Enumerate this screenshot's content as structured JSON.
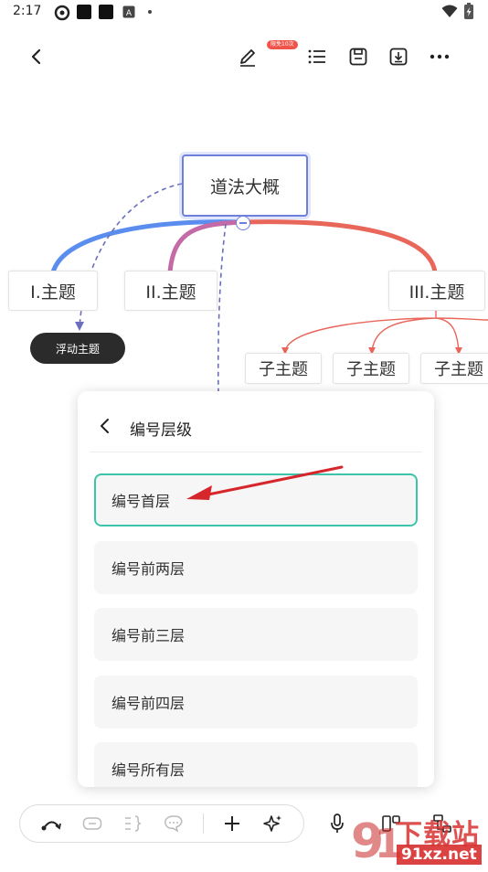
{
  "status_bar": {
    "time": "2:17"
  },
  "toolbar": {
    "badge": "限免10次"
  },
  "mindmap": {
    "root": "道法大概",
    "topic_1": "I.主题",
    "topic_2": "II.主题",
    "topic_3": "III.主题",
    "floating_topic": "浮动主题",
    "subtopics": [
      "子主题",
      "子主题",
      "子主题"
    ]
  },
  "panel": {
    "title": "编号层级",
    "options": [
      "编号首层",
      "编号前两层",
      "编号前三层",
      "编号前四层",
      "编号所有层"
    ],
    "selected_index": 0
  },
  "watermark": {
    "main": "下载站",
    "url": "91xz.net"
  },
  "colors": {
    "accent_teal": "#3cc4ab",
    "branch_blue": "#5b8def",
    "branch_pink": "#c46aa6",
    "branch_red": "#e8665a",
    "arrow_red": "#d6262b"
  }
}
